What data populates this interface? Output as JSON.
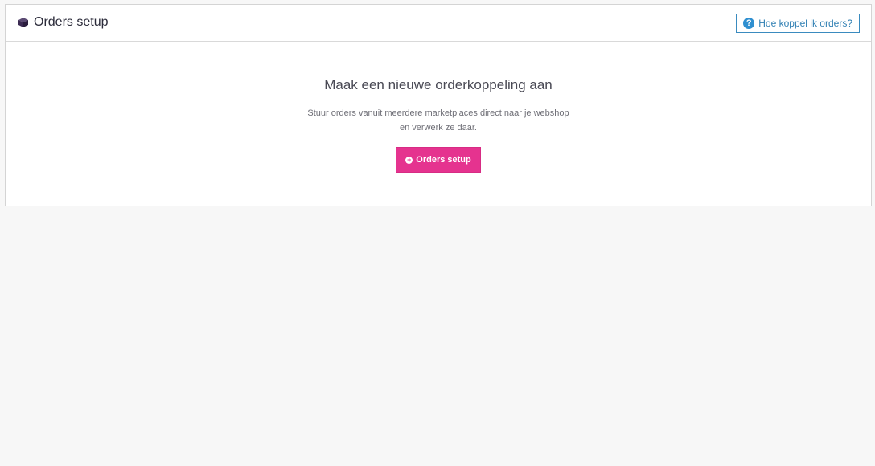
{
  "header": {
    "title": "Orders setup",
    "title_icon": "cube-icon",
    "help_button_label": "Hoe koppel ik orders?",
    "help_icon": "question-circle-icon"
  },
  "main": {
    "heading": "Maak een nieuwe orderkoppeling aan",
    "description_line1": "Stuur orders vanuit meerdere marketplaces direct naar je webshop",
    "description_line2": "en verwerk ze daar.",
    "button_label": "Orders setup",
    "button_icon": "plus-circle-icon"
  },
  "colors": {
    "accent": "#e5338f",
    "link": "#2f7fb3",
    "icon_purple": "#3b2a52"
  }
}
